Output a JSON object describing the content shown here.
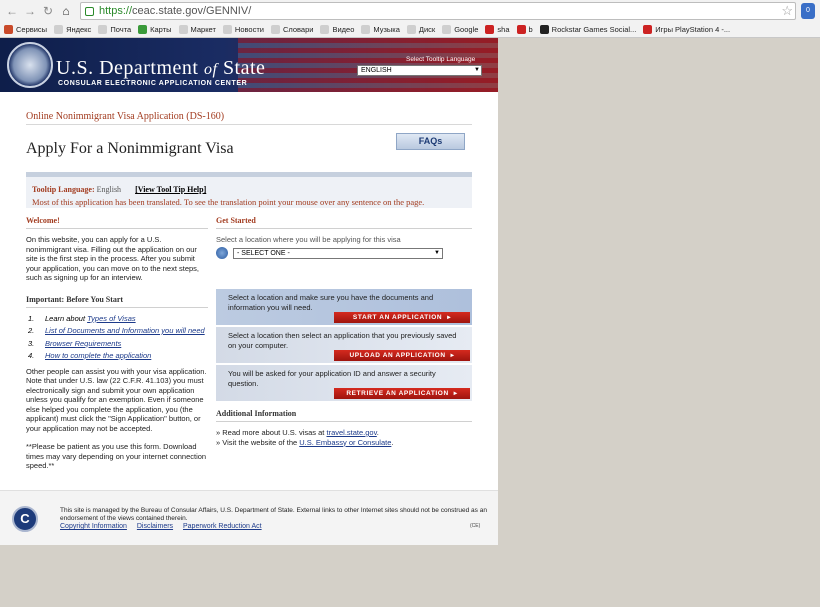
{
  "browser": {
    "url_protocol": "https://",
    "url_rest": "ceac.state.gov/GENNIV/",
    "ext_badge": "0",
    "bookmarks": [
      {
        "label": "Сервисы",
        "color": "#c94a2a"
      },
      {
        "label": "Яндекс",
        "color": "#cfcfcf"
      },
      {
        "label": "Почта",
        "color": "#cfcfcf"
      },
      {
        "label": "Карты",
        "color": "#3a9a3a"
      },
      {
        "label": "Маркет",
        "color": "#cfcfcf"
      },
      {
        "label": "Новости",
        "color": "#cfcfcf"
      },
      {
        "label": "Словари",
        "color": "#cfcfcf"
      },
      {
        "label": "Видео",
        "color": "#cfcfcf"
      },
      {
        "label": "Музыка",
        "color": "#cfcfcf"
      },
      {
        "label": "Диск",
        "color": "#cfcfcf"
      },
      {
        "label": "Google",
        "color": "#cfcfcf"
      },
      {
        "label": "sha",
        "color": "#cc2222"
      },
      {
        "label": "b",
        "color": "#cc2222"
      },
      {
        "label": "Rockstar Games Social...",
        "color": "#222222"
      },
      {
        "label": "Игры PlayStation 4 -...",
        "color": "#cc2222"
      }
    ]
  },
  "header": {
    "dept_name": "U.S. Department",
    "dept_of": "of",
    "dept_state": "State",
    "subtitle": "CONSULAR ELECTRONIC APPLICATION CENTER",
    "tooltip_label": "Select Tooltip Language",
    "language": "ENGLISH"
  },
  "page": {
    "app_title": "Online Nonimmigrant Visa Application (DS-160)",
    "heading": "Apply For a Nonimmigrant Visa",
    "faq_label": "FAQs"
  },
  "tooltip_box": {
    "label": "Tooltip Language:",
    "language": "English",
    "view_link": "[View Tool Tip Help]",
    "note": "Most of this application has been translated. To see the translation point your mouse over any sentence on the page."
  },
  "welcome": {
    "heading": "Welcome!",
    "text": "On this website, you can apply for a U.S. nonimmigrant visa. Filling out the application on our site is the first step in the process. After you submit your application, you can move on to the next steps, such as signing up for an interview.",
    "important_heading": "Important: Before You Start",
    "steps": [
      {
        "num": "1.",
        "prefix": "Learn about ",
        "link": "Types of Visas"
      },
      {
        "num": "2.",
        "prefix": "",
        "link": "List of Documents and Information you will need"
      },
      {
        "num": "3.",
        "prefix": "",
        "link": "Browser Requirements"
      },
      {
        "num": "4.",
        "prefix": "",
        "link": "How to complete the application"
      }
    ],
    "assist_text": "Other people can assist you with your visa application. Note that under U.S. law (22 C.F.R. 41.103) you must electronically sign and submit your own application unless you qualify for an exemption. Even if someone else helped you complete the application, you (the applicant) must click the \"Sign Application\" button, or your application may not be accepted.",
    "patience_text": "**Please be patient as you use this form. Download times may vary depending on your internet connection speed.**"
  },
  "get_started": {
    "heading": "Get Started",
    "location_help": "Select a location where you will be applying for this visa",
    "location_value": "- SELECT ONE -",
    "options": [
      {
        "text": "Select a location and make sure you have the documents and information you will need.",
        "button": "START AN APPLICATION"
      },
      {
        "text": "Select a location then select an application that you previously saved on your computer.",
        "button": "UPLOAD AN APPLICATION"
      },
      {
        "text": "You will be asked for your application ID and answer a security question.",
        "button": "RETRIEVE AN APPLICATION"
      }
    ]
  },
  "additional": {
    "heading": "Additional Information",
    "item1_prefix": "» Read more about U.S. visas at ",
    "item1_link": "travel.state.gov",
    "item1_suffix": ".",
    "item2_prefix": "» Visit the website of the ",
    "item2_link": "U.S. Embassy or Consulate",
    "item2_suffix": "."
  },
  "footer": {
    "logo_letter": "C",
    "text": "This site is managed by the Bureau of Consular Affairs, U.S. Department of State. External links to other Internet sites should not be construed as an endorsement of the views contained therein.",
    "links": [
      "Copyright Information",
      "Disclaimers",
      "Paperwork Reduction Act"
    ],
    "code": "(CE)"
  }
}
